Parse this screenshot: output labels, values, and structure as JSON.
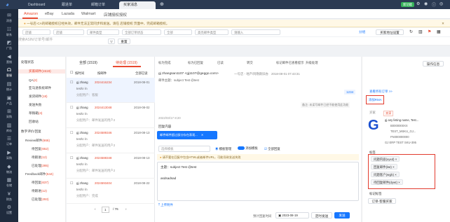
{
  "topbar": {
    "tabs": [
      "Dashboard",
      "跟进单",
      "邮箱订单",
      "买家消息"
    ],
    "status_badge": "新功能"
  },
  "rail": [
    {
      "label": "消息",
      "icon": "chat-icon"
    },
    {
      "label": "联系",
      "icon": "contacts-icon"
    },
    {
      "label": "广告",
      "icon": "ads-icon"
    },
    {
      "label": "营销",
      "icon": "megaphone-icon"
    },
    {
      "label": "客服",
      "icon": "headset-icon"
    },
    {
      "label": "统计",
      "icon": "chart-icon"
    },
    {
      "label": "产品",
      "icon": "box-icon"
    },
    {
      "label": "采购",
      "icon": "cart-icon"
    },
    {
      "label": "库存",
      "icon": "warehouse-icon"
    },
    {
      "label": "订单",
      "icon": "order-icon"
    },
    {
      "label": "采购",
      "icon": "truck-icon"
    },
    {
      "label": "物流",
      "icon": "ship-icon"
    },
    {
      "label": "仓储",
      "icon": "building-icon"
    },
    {
      "label": "财务",
      "icon": "money-icon"
    },
    {
      "label": "设置",
      "icon": "gear-icon"
    }
  ],
  "platform_tabs": [
    "Amazon",
    "eBay",
    "Lazada",
    "Walmart",
    "店铺授权授权"
  ],
  "notice": "一号店-CA的邮箱授权已经失效，邮件无法正常同步和发送。请在 店铺授权 页面中，完成邮箱授权。",
  "filters": {
    "row1": [
      "店铺",
      "店铺",
      "邮件类型",
      "全部订单状态",
      "全部",
      "高亮邮件类型",
      "请输入"
    ],
    "search_placeholder": "搜索ASIN/订单号/邮件",
    "right_links": [
      "分组",
      "买家地址设置"
    ],
    "reset": "重置"
  },
  "left_panel": {
    "items": [
      {
        "label": "处理状态",
        "count": ""
      },
      {
        "label": "买家邮件",
        "count": "(1519)"
      },
      {
        "label": "QA",
        "count": "(2)"
      },
      {
        "label": "亚马逊系统邮件",
        "count": ""
      },
      {
        "label": "发货邮件",
        "count": "(18)"
      },
      {
        "label": "发送失败",
        "count": ""
      },
      {
        "label": "草稿箱",
        "count": "(4)"
      },
      {
        "label": "回收站",
        "count": ""
      },
      {
        "label": "数字评价/回复",
        "count": ""
      },
      {
        "label": "Review邮件",
        "count": "(666)"
      },
      {
        "label": "待回复",
        "count": "(652)"
      },
      {
        "label": "待跟进",
        "count": "(12)"
      },
      {
        "label": "已处理",
        "count": "(285)"
      },
      {
        "label": "Feedback邮件",
        "count": "(644)"
      },
      {
        "label": "待回复",
        "count": "(637)"
      },
      {
        "label": "待跟进",
        "count": "(12)"
      },
      {
        "label": "已处理",
        "count": "(293)"
      }
    ]
  },
  "message_list": {
    "tabs": [
      "全部 (1519)",
      "待处理 (1519)"
    ],
    "sort": "按邮件",
    "checkbox_label": "按时间",
    "unread_toggle": "全部已读",
    "items": [
      {
        "from": "gj zhang",
        "order": "2024416234",
        "date": "2018-08-01",
        "subject": "test\\n \\n",
        "note": "分配用户：客服"
      },
      {
        "from": "gj zhang",
        "order": "2024413048",
        "date": "2018-08-02",
        "subject": "test\\n \\n",
        "note": "分配用户：邮件发送的用户2"
      },
      {
        "from": "gj zhang",
        "order": "2024589346",
        "date": "2018-08-13",
        "subject": "test\\n \\n",
        "note": "分配用户：邮件发送的用户2"
      },
      {
        "from": "gj zhang",
        "order": "2024588348",
        "date": "2018-08-13",
        "subject": "test\\n \\n",
        "note": "分配用户：邮件发送的用户2"
      },
      {
        "from": "gj zhang",
        "order": "2024593404",
        "date": "2018-08-22",
        "subject": "test\\n \\n",
        "note": "分配用户：完成"
      }
    ],
    "pagination": {
      "current": "1",
      "total": "/ 76"
    }
  },
  "conversation": {
    "toolbar": [
      "标为完成",
      "标为已回复",
      "已读",
      "转交",
      "标记邮件已查看提示",
      "升级处理"
    ],
    "from_line": "gj zhangsan1107 <gj1107@geggo.com>",
    "meta": "一号店 - 地产/阿勒斯旧办",
    "date": "2018-08-01 07:43:31",
    "subject_label": "邮件主题：subject Test @test",
    "id_badge": "1234",
    "translate_note": "备注: 未读写邮件已经不能使用此功能",
    "timestamp2": "2022/03/17 8:20",
    "reply_label": "回复内容",
    "tooltip": "邮件邮件超过部分存在表现...",
    "template_placeholder": "选择模板",
    "toggles": [
      "模板管理",
      "添加模板",
      "全部回复"
    ],
    "warning": "请不要在回复中包含HTML或者邮件URL，可能导致发送失败",
    "subject_field": "主题：subject Test @test",
    "body_text": "asdsadsad",
    "attach": "上传附件",
    "send_time_label": "预计回复时间",
    "send_date": "2023-08-19",
    "schedule": "定时发送",
    "send": "发送"
  },
  "right_panel": {
    "header": "操作信息",
    "buyer_order": "查看所有订单 >>",
    "add_rma": "添加RMA",
    "buyer_label": "买家",
    "buyer_name": "卖家",
    "product_title": "gj any listing name, Test...",
    "asin": "B0000000XX",
    "msku": "TEST_MSKU_GJ...",
    "fnsku": "FN000000000",
    "seller": "GJ ERP TEST SKU-395",
    "tag_title": "标签",
    "tags": [
      "问题内容(xyxd)",
      "回复邮件(lwt)",
      "问题客户(wyjk)",
      "待回复邮件(dywt)"
    ],
    "tag_title2": "标记标签",
    "bottom_link": "订单-客服买家"
  },
  "accent": "#e8492f",
  "primary": "#1677ff"
}
